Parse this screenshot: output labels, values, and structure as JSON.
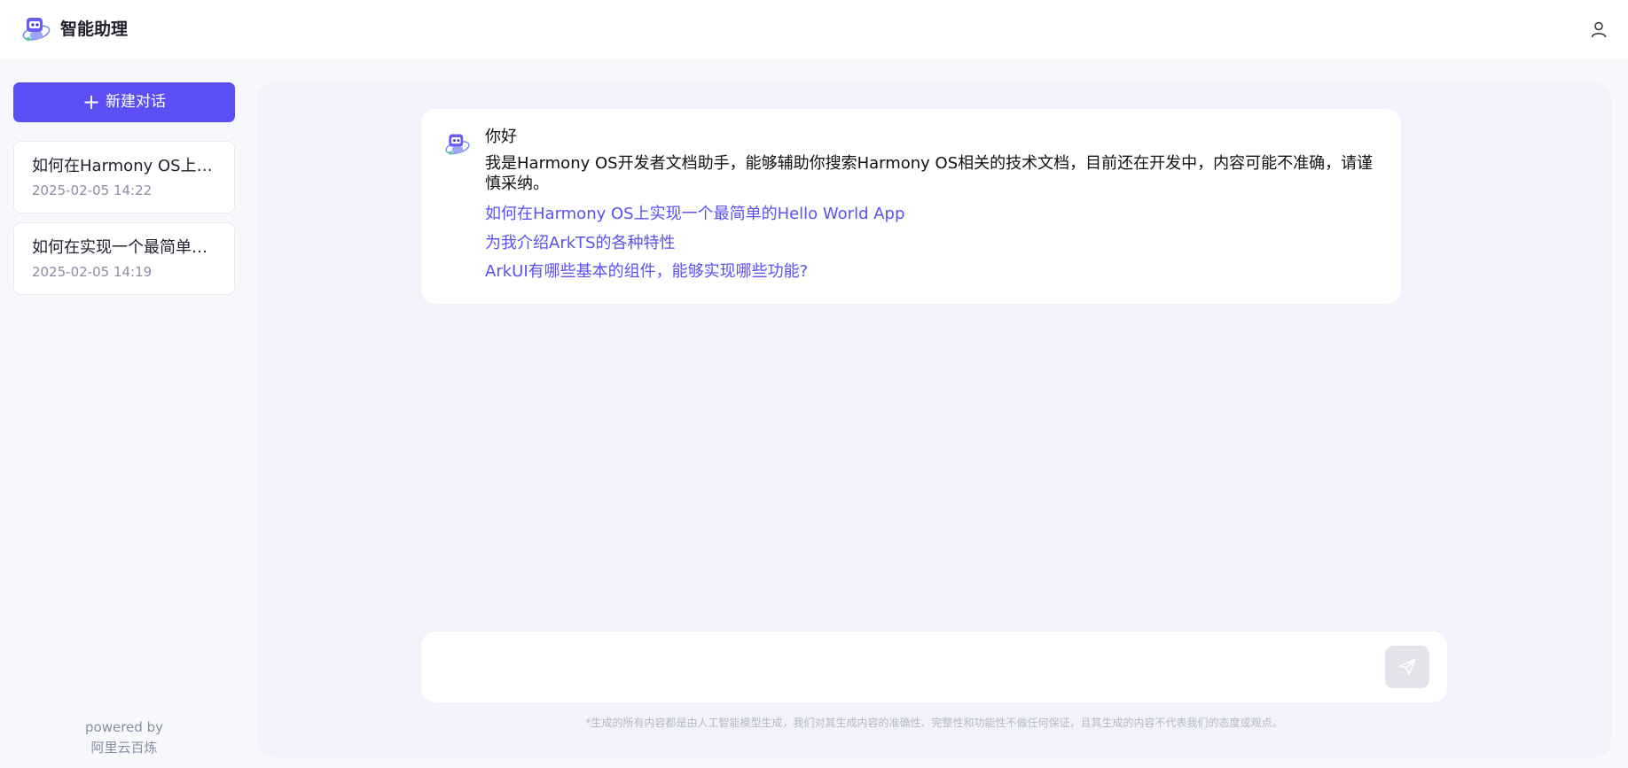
{
  "header": {
    "app_title": "智能助理",
    "logo_icon": "robot-logo-icon",
    "user_icon": "user-icon"
  },
  "sidebar": {
    "new_chat_label": "新建对话",
    "conversations": [
      {
        "title": "如何在Harmony OS上实现一个最简单的Hello World App",
        "time": "2025-02-05 14:22"
      },
      {
        "title": "如何在实现一个最简单的Hello World App",
        "time": "2025-02-05 14:19"
      }
    ],
    "powered_by": "powered by",
    "provider": "阿里云百炼"
  },
  "chat": {
    "greeting": "你好",
    "intro": "我是Harmony OS开发者文档助手，能够辅助你搜索Harmony OS相关的技术文档，目前还在开发中，内容可能不准确，请谨慎采纳。",
    "suggestions": [
      "如何在Harmony OS上实现一个最简单的Hello World App",
      "为我介绍ArkTS的各种特性",
      "ArkUI有哪些基本的组件，能够实现哪些功能?"
    ]
  },
  "input": {
    "placeholder": "",
    "send_icon": "send-icon",
    "disclaimer": "*生成的所有内容都是由人工智能模型生成，我们对其生成内容的准确性、完整性和功能性不做任何保证，且其生成的内容不代表我们的态度或观点。"
  },
  "colors": {
    "accent": "#5b4ff5",
    "page_bg": "#f7f8fc",
    "main_bg": "#f1f2fb"
  }
}
